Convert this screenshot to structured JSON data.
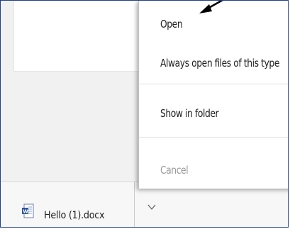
{
  "menu": {
    "items": [
      {
        "label": "Open",
        "enabled": true
      },
      {
        "label": "Always open files of this type",
        "enabled": true
      },
      {
        "label": "Show in folder",
        "enabled": true
      },
      {
        "label": "Cancel",
        "enabled": false
      }
    ]
  },
  "download": {
    "file_name": "Hello (1).docx",
    "file_icon": "word-document-icon",
    "chevron_icon": "chevron-down-icon"
  },
  "annotation": {
    "icon": "arrow-pointer-icon",
    "color": "#000000"
  },
  "colors": {
    "frame_border": "#1f3d8a",
    "menu_text": "#202020",
    "disabled_text": "#9a9a9a",
    "word_blue": "#2b579a"
  }
}
